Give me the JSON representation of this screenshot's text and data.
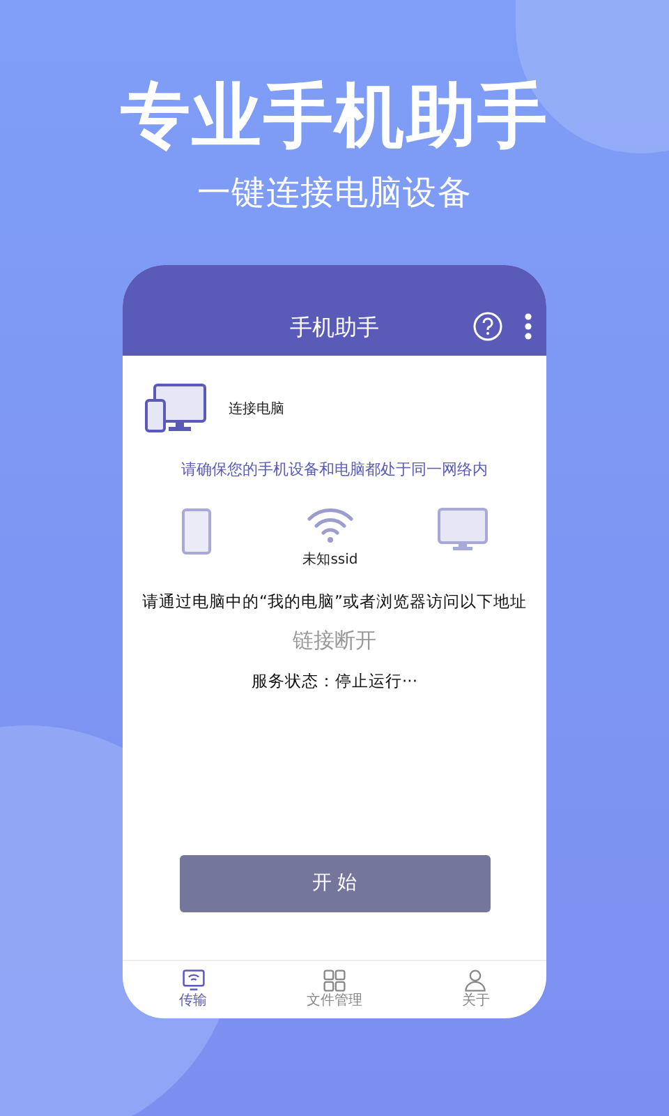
{
  "headline": "专业手机助手",
  "subheadline": "一键连接电脑设备",
  "app": {
    "title": "手机助手",
    "connect_label": "连接电脑",
    "hint": "请确保您的手机设备和电脑都处于同一网络内",
    "ssid": "未知ssid",
    "instruction": "请通过电脑中的“我的电脑”或者浏览器访问以下地址",
    "link_status": "链接断开",
    "service_status": "服务状态：停止运行···",
    "start_button": "开 始",
    "tabs": [
      {
        "label": "传输",
        "kind": "transfer",
        "selected": true
      },
      {
        "label": "文件管理",
        "kind": "files",
        "selected": false
      },
      {
        "label": "关于",
        "kind": "about",
        "selected": false
      }
    ]
  }
}
